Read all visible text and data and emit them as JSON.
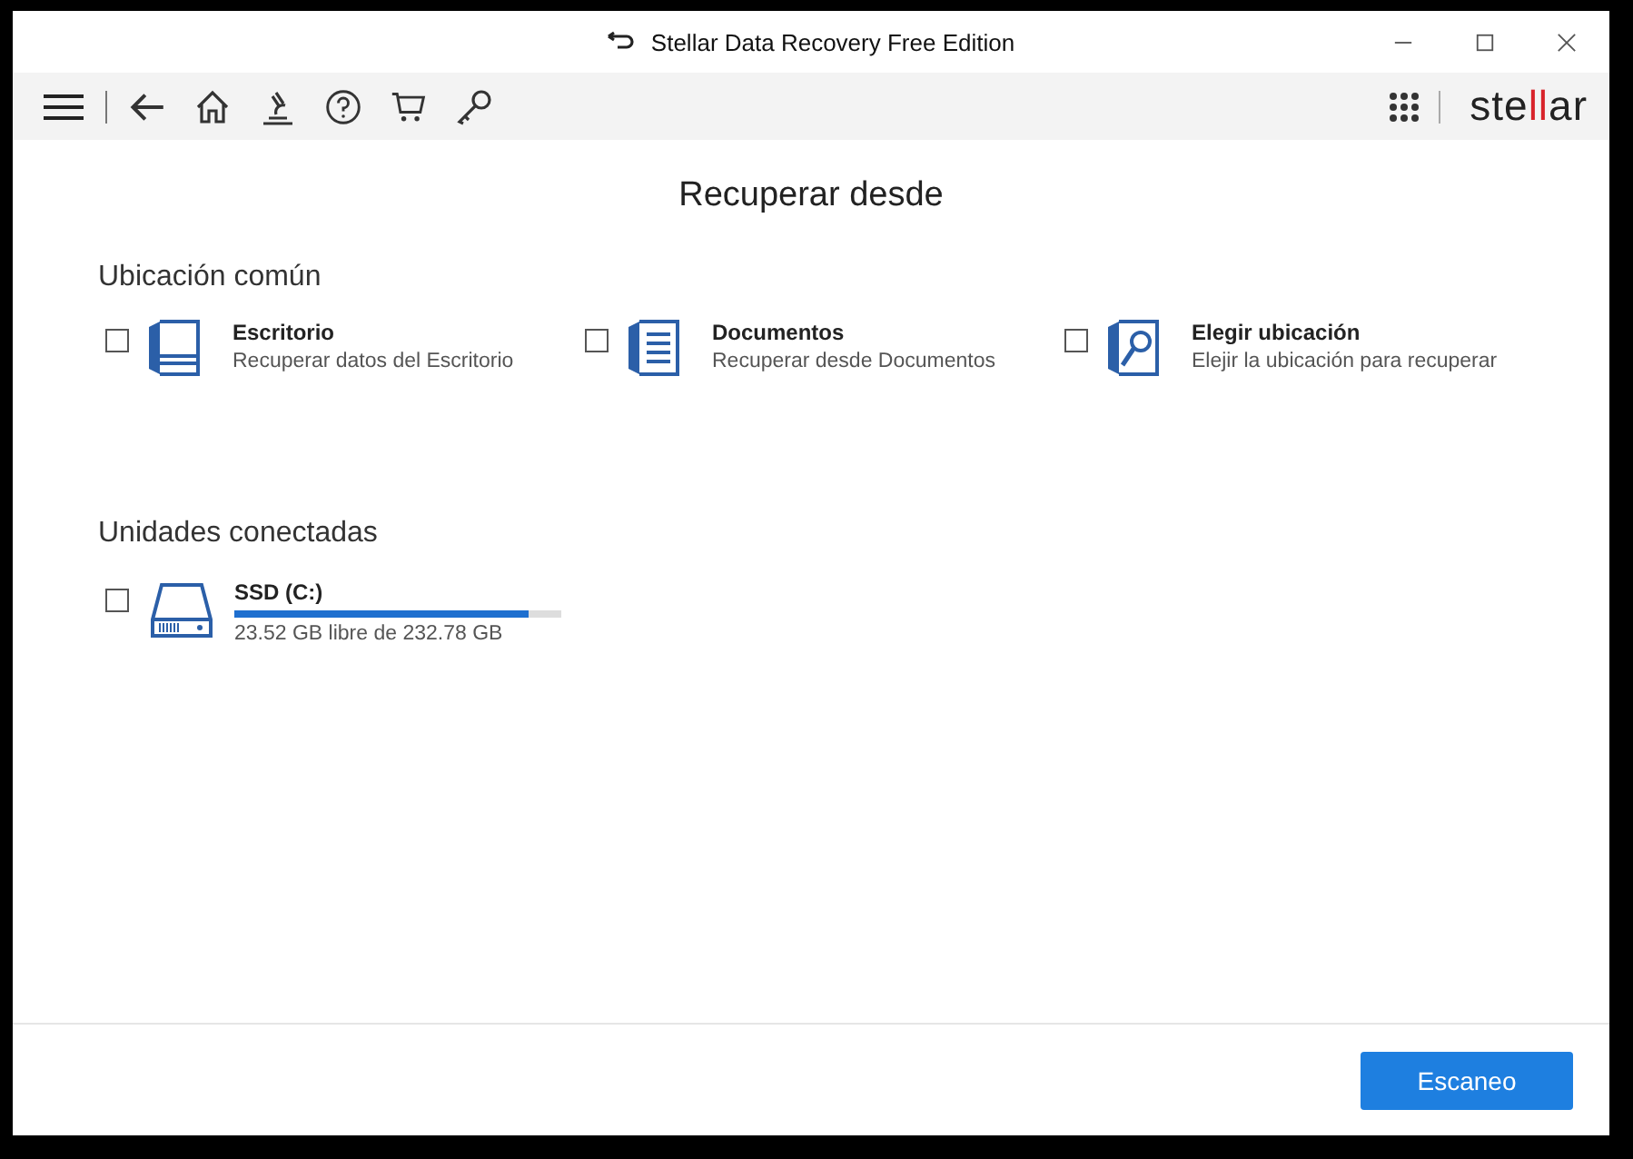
{
  "window": {
    "title": "Stellar Data Recovery Free Edition"
  },
  "logo": [
    {
      "text": "ste",
      "accent": false
    },
    {
      "text": "ll",
      "accent": true
    },
    {
      "text": "ar",
      "accent": false
    }
  ],
  "heading": "Recuperar desde",
  "common_locations": {
    "title": "Ubicación común",
    "items": [
      {
        "kind": "desktop",
        "name": "Escritorio",
        "description": "Recuperar datos del Escritorio",
        "checked": false
      },
      {
        "kind": "documents",
        "name": "Documentos",
        "description": "Recuperar desde Documentos",
        "checked": false
      },
      {
        "kind": "choose",
        "name": "Elegir ubicación",
        "description": "Elejir la ubicación para recuperar",
        "checked": false
      }
    ]
  },
  "connected_drives": {
    "title": "Unidades conectadas",
    "items": [
      {
        "name": "SSD (C:)",
        "level": 0.9,
        "reading": "23.52 GB libre de 232.78 GB",
        "checked": false
      }
    ]
  },
  "buttons": [
    {
      "label": "Escaneo"
    }
  ]
}
